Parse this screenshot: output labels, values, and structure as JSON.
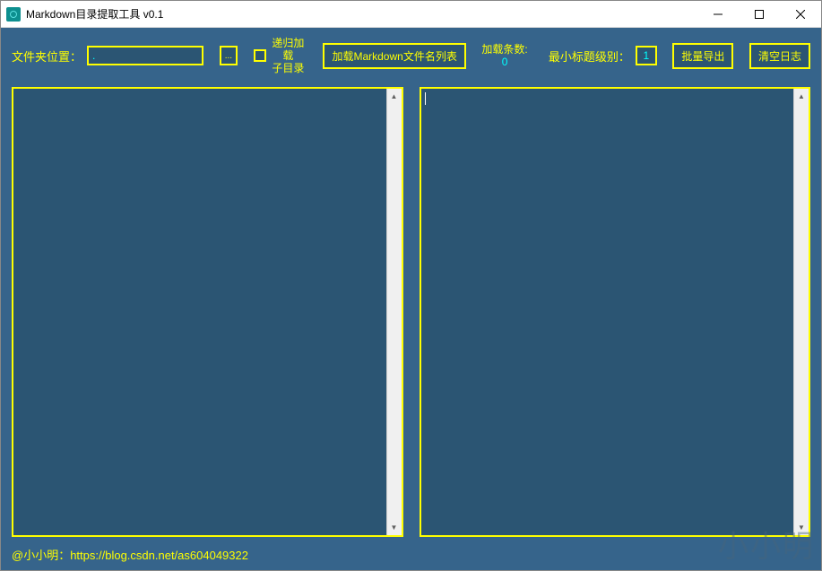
{
  "window": {
    "title": "Markdown目录提取工具 v0.1"
  },
  "toolbar": {
    "folder_label": "文件夹位置：",
    "folder_value": ".",
    "browse_label": "...",
    "recursive_label": "递归加载\n子目录",
    "load_button": "加载Markdown文件名列表",
    "count_label": "加载条数:",
    "count_value": "0",
    "min_level_label": "最小标题级别：",
    "min_level_value": "1",
    "export_button": "批量导出",
    "clear_button": "清空日志"
  },
  "footer": {
    "author": "@小小明：",
    "link": "https://blog.csdn.net/as604049322"
  },
  "watermark": "小小明"
}
